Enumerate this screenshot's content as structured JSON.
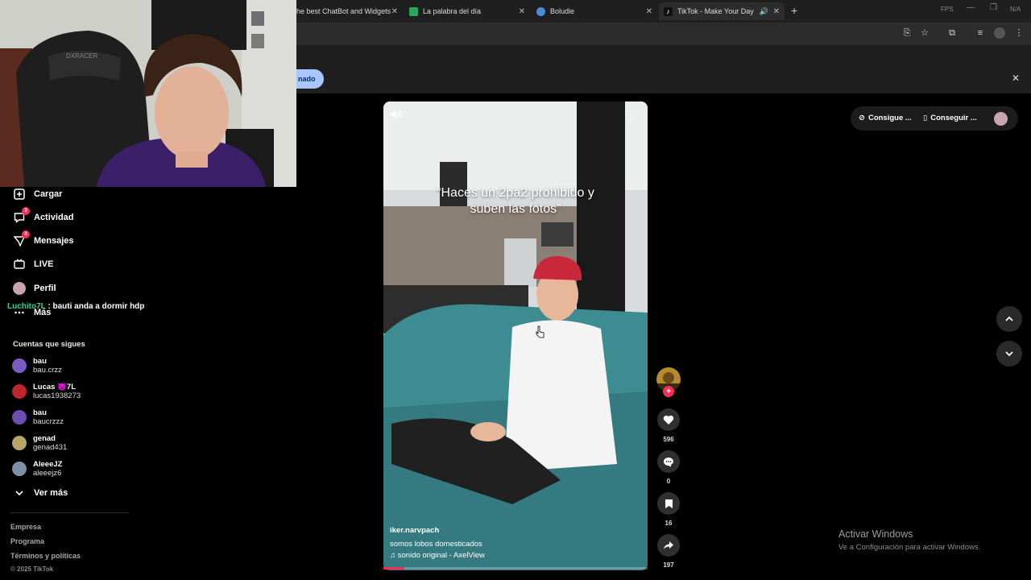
{
  "browser": {
    "tabs": [
      {
        "title": "he best ChatBot and Widgets",
        "close": "✕",
        "favicon_color": "#1f1f1f"
      },
      {
        "title": "La palabra del día",
        "close": "✕",
        "favicon_color": "#2aa85a"
      },
      {
        "title": "Boludle",
        "close": "✕",
        "favicon_color": "#4b8ad6"
      },
      {
        "title": "TikTok - Make Your Day",
        "close": "✕",
        "favicon_color": "#ffffff"
      }
    ],
    "new_tab": "+",
    "overlay_corner_1": "FPS",
    "overlay_corner_2": "N/A",
    "infobar_pill": "nado",
    "infobar_close": "✕"
  },
  "sidebar": {
    "items": [
      {
        "label": "Cargar",
        "icon": "upload-icon",
        "badge": ""
      },
      {
        "label": "Actividad",
        "icon": "activity-icon",
        "badge": "3"
      },
      {
        "label": "Mensajes",
        "icon": "messages-icon",
        "badge": "3"
      },
      {
        "label": "LIVE",
        "icon": "live-icon",
        "badge": ""
      },
      {
        "label": "Perfil",
        "icon": "profile-avatar",
        "badge": ""
      },
      {
        "label": "Más",
        "icon": "more-icon",
        "badge": ""
      }
    ],
    "chat": {
      "user": "Luchito7L",
      "sep": ":",
      "message": "bauti anda a dormir hdp"
    },
    "following_title": "Cuentas que sigues",
    "following": [
      {
        "name": "bau",
        "handle": "bau.crzz",
        "color": "#7a5cc1"
      },
      {
        "name": "Lucas 👿7L",
        "handle": "lucas1938273",
        "color": "#c0242f"
      },
      {
        "name": "bau",
        "handle": "baucrzzz",
        "color": "#6b4fb0"
      },
      {
        "name": "genad",
        "handle": "genad431",
        "color": "#b8a56a"
      },
      {
        "name": "AleeeJZ",
        "handle": "aleeejz6",
        "color": "#7f8fa6"
      }
    ],
    "see_more": "Ver más",
    "footer": [
      "Empresa",
      "Programa",
      "Términos y políticas"
    ],
    "copyright": "© 2025 TikTok"
  },
  "video": {
    "caption": "“Haces un 2pa2 prohibido y suben las fotos”",
    "author": "iker.narvpach",
    "description": "somos lobos domesticados",
    "sound": "sonido original - AxelView",
    "progress": 0.08,
    "likes": "596",
    "comments": "0",
    "saves": "16",
    "shares": "197",
    "follow_plus": "+"
  },
  "topbar": {
    "coins": "Consigue ...",
    "app": "Conseguir ..."
  },
  "windows": {
    "title": "Activar Windows",
    "subtitle": "Ve a Configuración para activar Windows."
  },
  "colors": {
    "accent": "#fe2c55",
    "chat_user": "#35d08e"
  }
}
